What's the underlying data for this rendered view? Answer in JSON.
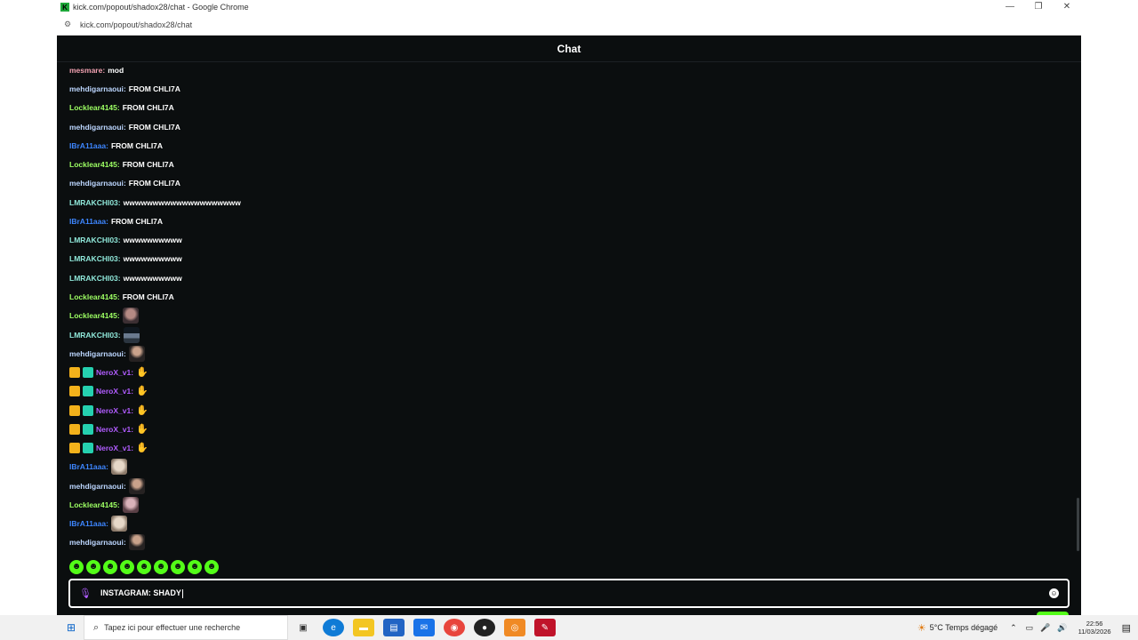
{
  "browser": {
    "title": "kick.com/popout/shadox28/chat - Google Chrome",
    "url": "kick.com/popout/shadox28/chat",
    "favicon_letter": "K"
  },
  "chat": {
    "header": "Chat",
    "messages": [
      {
        "user": "mesmare",
        "text": "mod"
      },
      {
        "user": "mehdigarnaoui",
        "text": "FROM CHLI7A"
      },
      {
        "user": "Locklear4145",
        "text": "FROM CHLI7A"
      },
      {
        "user": "mehdigarnaoui",
        "text": "FROM CHLI7A"
      },
      {
        "user": "IBrA11aaa",
        "text": "FROM CHLI7A"
      },
      {
        "user": "Locklear4145",
        "text": "FROM CHLI7A"
      },
      {
        "user": "mehdigarnaoui",
        "text": "FROM CHLI7A"
      },
      {
        "user": "LMRAKCHI03",
        "text": "wwwwwwwwwwwwwwwwwwww"
      },
      {
        "user": "IBrA11aaa",
        "text": "FROM CHLI7A"
      },
      {
        "user": "LMRAKCHI03",
        "text": "wwwwwwwwww"
      },
      {
        "user": "LMRAKCHI03",
        "text": "wwwwwwwwww"
      },
      {
        "user": "LMRAKCHI03",
        "text": "wwwwwwwwww"
      },
      {
        "user": "Locklear4145",
        "text": "FROM CHLI7A"
      },
      {
        "user": "Locklear4145",
        "emote": "face-emote"
      },
      {
        "user": "LMRAKCHI03",
        "emote": "car-emote"
      },
      {
        "user": "mehdigarnaoui",
        "emote": "man-emote"
      },
      {
        "user": "NeroX_v1",
        "emote": "hands-emote"
      },
      {
        "user": "NeroX_v1",
        "emote": "hands-emote"
      },
      {
        "user": "NeroX_v1",
        "emote": "hands-emote"
      },
      {
        "user": "NeroX_v1",
        "emote": "hands-emote"
      },
      {
        "user": "NeroX_v1",
        "emote": "hands-emote"
      },
      {
        "user": "IBrA11aaa",
        "emote": "dog-emote"
      },
      {
        "user": "mehdigarnaoui",
        "emote": "man-emote"
      },
      {
        "user": "Locklear4145",
        "emote": "lady-emote"
      },
      {
        "user": "IBrA11aaa",
        "emote": "dog-emote"
      },
      {
        "user": "mehdigarnaoui",
        "emote": "man-emote"
      }
    ],
    "input_value": "INSTAGRAM: SHADY",
    "colors": {
      "accent": "#53fc18",
      "background": "#0b0e0f"
    }
  },
  "taskbar": {
    "search_placeholder": "Tapez ici pour effectuer une recherche",
    "weather": "5°C  Temps dégagé",
    "time": "22:56",
    "date": "11/03/2026"
  }
}
